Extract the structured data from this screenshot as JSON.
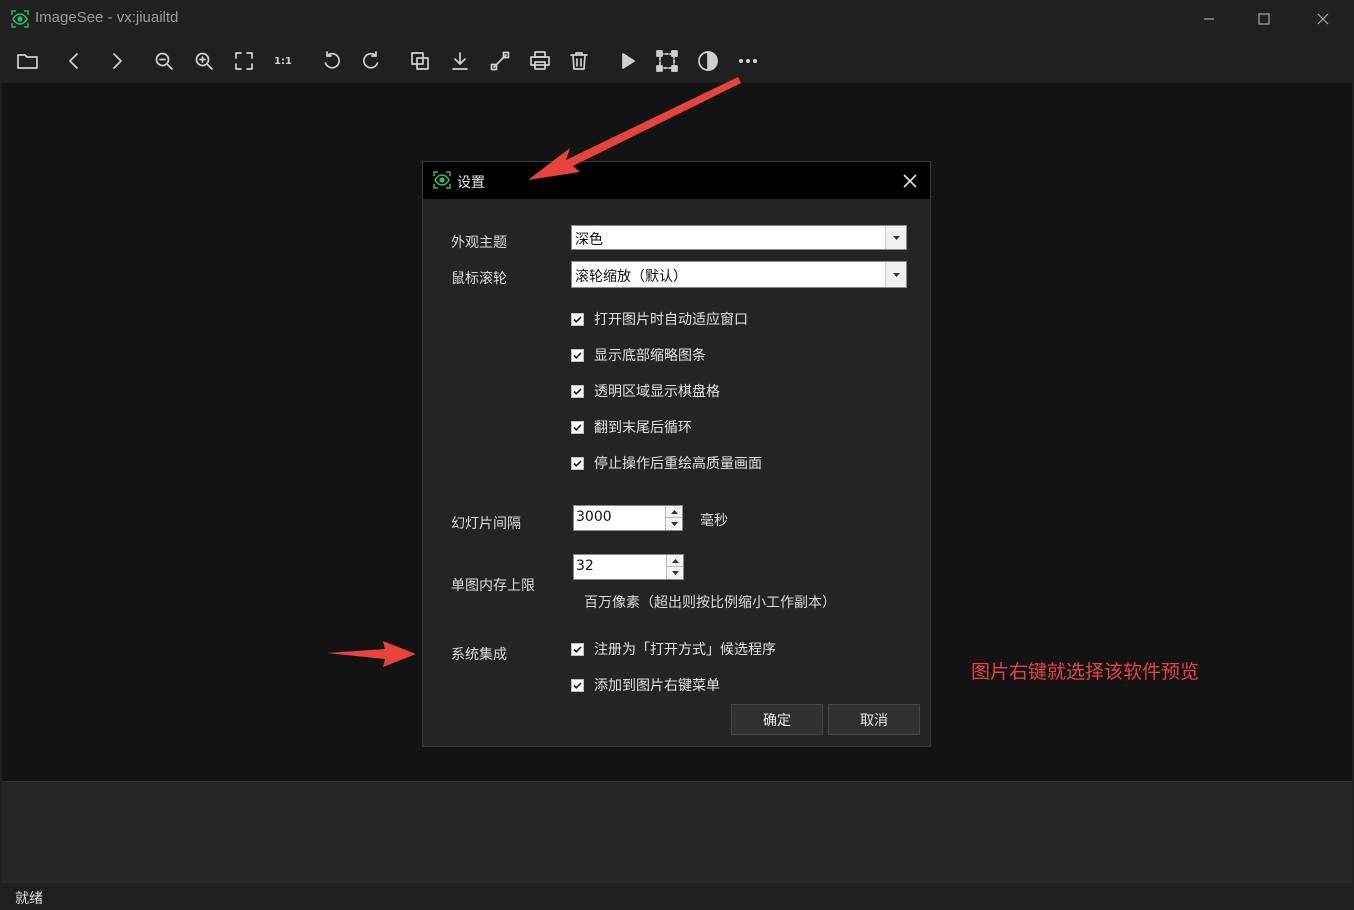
{
  "window": {
    "title": "ImageSee - vx:jiuailtd",
    "controls": [
      "minimize",
      "maximize",
      "close"
    ]
  },
  "toolbar": {
    "items": [
      {
        "icon": "folder-icon",
        "name": "open"
      },
      {
        "icon": "chevron-left-icon",
        "name": "previous"
      },
      {
        "icon": "chevron-right-icon",
        "name": "next"
      },
      {
        "icon": "zoom-out-icon",
        "name": "zoom-out"
      },
      {
        "icon": "zoom-in-icon",
        "name": "zoom-in"
      },
      {
        "icon": "fit-window-icon",
        "name": "fit-window"
      },
      {
        "icon": "actual-size-icon",
        "name": "actual-size",
        "text": "1:1"
      },
      {
        "icon": "rotate-left-icon",
        "name": "rotate-left"
      },
      {
        "icon": "rotate-right-icon",
        "name": "rotate-right"
      },
      {
        "icon": "copy-icon",
        "name": "copy"
      },
      {
        "icon": "download-icon",
        "name": "save"
      },
      {
        "icon": "resize-icon",
        "name": "resize"
      },
      {
        "icon": "print-icon",
        "name": "print"
      },
      {
        "icon": "trash-icon",
        "name": "delete"
      },
      {
        "icon": "play-icon",
        "name": "slideshow"
      },
      {
        "icon": "crop-icon",
        "name": "crop"
      },
      {
        "icon": "contrast-icon",
        "name": "theme"
      },
      {
        "icon": "more-icon",
        "name": "more"
      }
    ]
  },
  "status": {
    "text": "就绪"
  },
  "settings": {
    "title": "设置",
    "theme": {
      "label": "外观主题",
      "value": "深色"
    },
    "wheel": {
      "label": "鼠标滚轮",
      "value": "滚轮缩放（默认）"
    },
    "checkboxes": [
      {
        "label": "打开图片时自动适应窗口",
        "checked": true
      },
      {
        "label": "显示底部缩略图条",
        "checked": true
      },
      {
        "label": "透明区域显示棋盘格",
        "checked": true
      },
      {
        "label": "翻到末尾后循环",
        "checked": true
      },
      {
        "label": "停止操作后重绘高质量画面",
        "checked": true
      }
    ],
    "slideshow": {
      "label": "幻灯片间隔",
      "value": "3000",
      "unit": "毫秒"
    },
    "memory": {
      "label": "单图内存上限",
      "value": "32",
      "note": "百万像素（超出则按比例缩小工作副本）"
    },
    "integration": {
      "label": "系统集成",
      "options": [
        {
          "label": "注册为「打开方式」候选程序",
          "checked": true
        },
        {
          "label": "添加到图片右键菜单",
          "checked": true
        }
      ]
    },
    "ok_label": "确定",
    "cancel_label": "取消"
  },
  "annotation": {
    "text": "图片右键就选择该软件预览",
    "color": "#e8423e"
  }
}
